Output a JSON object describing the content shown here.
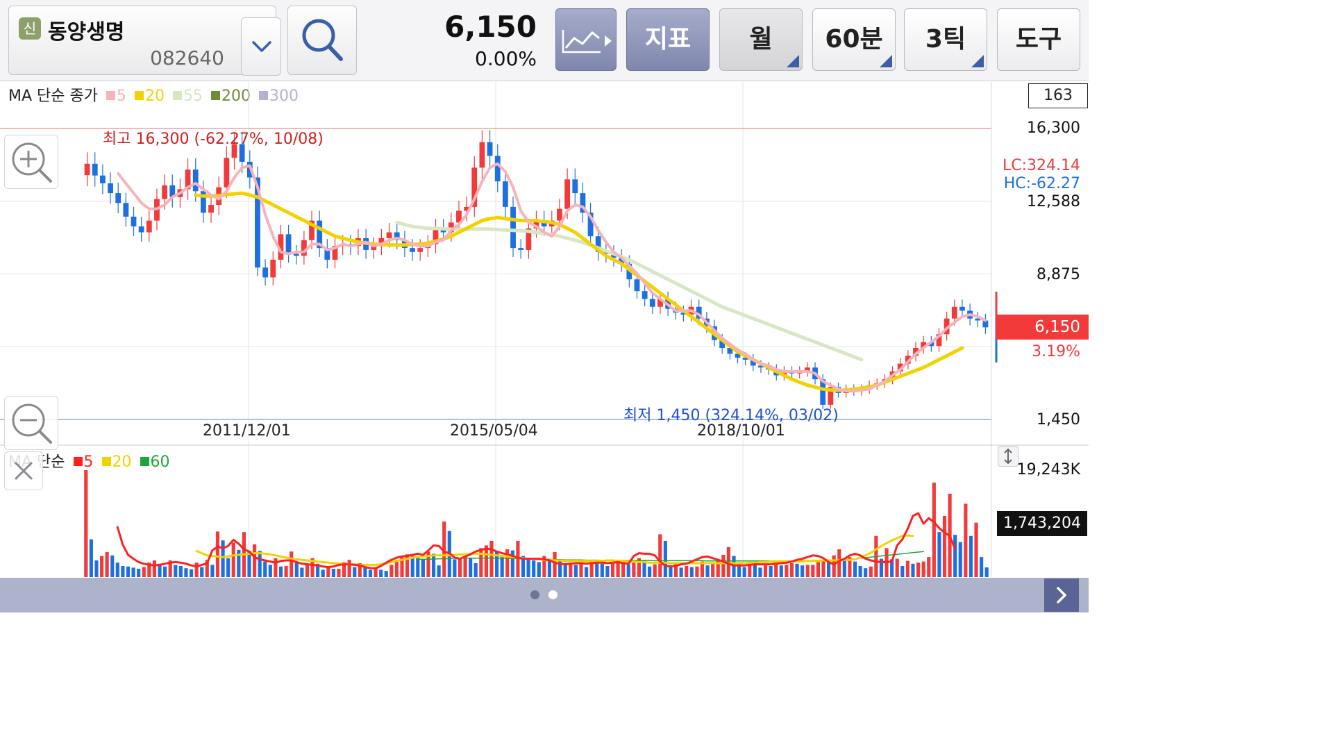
{
  "stock": {
    "badge": "신",
    "name": "동양생명",
    "code": "082640",
    "price": "6,150",
    "change": "0.00%"
  },
  "toolbar": {
    "indicator_label": "지표",
    "period_label": "월",
    "minute_label": "60분",
    "tick_label": "3틱",
    "tools_label": "도구"
  },
  "main_chart": {
    "legend_title": "MA 단순 종가",
    "legend_items": [
      {
        "label": "5",
        "color": "#f6b3ba"
      },
      {
        "label": "20",
        "color": "#f2d200"
      },
      {
        "label": "55",
        "color": "#d8e6c4"
      },
      {
        "label": "200",
        "color": "#6f8b3a"
      },
      {
        "label": "300",
        "color": "#b9aed6"
      }
    ],
    "count_box": "163",
    "high_label": "최고 16,300 (-62.27%, 10/08)",
    "low_label": "최저 1,450 (324.14%, 03/02)",
    "lc_label": "LC:324.14",
    "hc_label": "HC:-62.27",
    "y_labels": [
      "16,300",
      "12,588",
      "8,875",
      "1,450"
    ],
    "price_tag": "6,150",
    "price_pct": "3.19%",
    "x_labels": [
      "2011/12/01",
      "2015/05/04",
      "2018/10/01"
    ]
  },
  "volume_chart": {
    "legend_title": "MA 단순",
    "legend_items": [
      {
        "label": "5",
        "color": "#ff2020"
      },
      {
        "label": "20",
        "color": "#f2d200"
      },
      {
        "label": "60",
        "color": "#1aa63a"
      }
    ],
    "max_label": "19,243K",
    "current_label": "1,743,204"
  },
  "colors": {
    "up": "#f23a3a",
    "down": "#1e6fe0",
    "accent": "#7f87ae"
  },
  "chart_data": [
    {
      "type": "candlestick",
      "y_range": [
        1450,
        16300
      ],
      "y_ticks": [
        16300,
        12588,
        8875,
        5162,
        1450
      ],
      "x_tick_labels": [
        "2011/12/01",
        "2015/05/04",
        "2018/10/01"
      ],
      "last_close": 6150,
      "high": 16300,
      "low": 1450,
      "close": [
        14500,
        13900,
        13500,
        13000,
        12500,
        11800,
        11300,
        11000,
        11600,
        12700,
        13400,
        12800,
        13200,
        14200,
        13100,
        12000,
        12400,
        13300,
        14800,
        15500,
        14600,
        13800,
        9200,
        8700,
        9600,
        10900,
        9900,
        9800,
        10600,
        11600,
        10200,
        9600,
        10300,
        10400,
        10300,
        10700,
        10100,
        10300,
        10700,
        11000,
        10600,
        10200,
        10000,
        10200,
        10400,
        11200,
        11000,
        11500,
        12100,
        12300,
        14300,
        15600,
        14900,
        13600,
        12300,
        10200,
        10100,
        11200,
        11600,
        11300,
        11600,
        12200,
        13700,
        13000,
        12000,
        10800,
        10000,
        9900,
        9700,
        9400,
        8600,
        8000,
        7600,
        7200,
        7600,
        7100,
        6900,
        6800,
        7200,
        6600,
        6200,
        5500,
        5100,
        4800,
        4600,
        4500,
        4200,
        4100,
        4000,
        3700,
        3900,
        3800,
        3900,
        4100,
        3500,
        2200,
        3100,
        2800,
        3000,
        2900,
        3000,
        3200,
        3300,
        3500,
        3900,
        4300,
        4700,
        5100,
        5400,
        5200,
        5800,
        6600,
        7200,
        7000,
        6600,
        6500,
        6150
      ],
      "ma20": [
        null,
        null,
        null,
        null,
        null,
        null,
        null,
        null,
        null,
        null,
        null,
        null,
        null,
        null,
        12900,
        12850,
        12850,
        12880,
        12920,
        12960,
        13000,
        12900,
        12800,
        12600,
        12400,
        12200,
        12000,
        11800,
        11600,
        11400,
        11200,
        11000,
        10800,
        10700,
        10600,
        10500,
        10450,
        10400,
        10380,
        10360,
        10350,
        10360,
        10380,
        10400,
        10450,
        10550,
        10650,
        10800,
        11000,
        11200,
        11400,
        11600,
        11700,
        11750,
        11700,
        11650,
        11600,
        11600,
        11600,
        11550,
        11500,
        11400,
        11200,
        11000,
        10700,
        10400,
        10100,
        9800,
        9600,
        9400,
        9100,
        8800,
        8500,
        8200,
        7900,
        7600,
        7300,
        7000,
        6700,
        6400,
        6100,
        5800,
        5500,
        5200,
        4900,
        4700,
        4500,
        4300,
        4100,
        3900,
        3700,
        3500,
        3350,
        3200,
        3100,
        3000,
        2950,
        2950,
        2950,
        3000,
        3050,
        3100,
        3200,
        3350,
        3500,
        3650,
        3800,
        3950,
        4100,
        4300,
        4500,
        4700,
        4900,
        5100
      ],
      "ma55": [
        null,
        null,
        null,
        null,
        null,
        null,
        null,
        null,
        null,
        null,
        null,
        null,
        null,
        null,
        null,
        null,
        null,
        null,
        null,
        null,
        null,
        null,
        null,
        null,
        null,
        null,
        null,
        null,
        null,
        null,
        null,
        null,
        null,
        null,
        null,
        null,
        null,
        null,
        null,
        null,
        11500,
        11400,
        11300,
        11250,
        11200,
        11200,
        11180,
        11160,
        11150,
        11150,
        11160,
        11170,
        11160,
        11140,
        11120,
        11100,
        11080,
        11050,
        11000,
        10950,
        10880,
        10800,
        10700,
        10600,
        10480,
        10350,
        10200,
        10050,
        9900,
        9750,
        9600,
        9400,
        9200,
        9000,
        8800,
        8600,
        8400,
        8200,
        8000,
        7800,
        7600,
        7400,
        7200,
        7050,
        6900,
        6750,
        6600,
        6450,
        6300,
        6150,
        6000,
        5850,
        5700,
        5550,
        5400,
        5250,
        5100,
        4950,
        4800,
        4650,
        4500
      ],
      "ma5": [
        null,
        null,
        null,
        null,
        14000,
        13500,
        13000,
        12500,
        12200,
        12200,
        12400,
        12800,
        13000,
        13300,
        13500,
        13200,
        12900,
        12700,
        13100,
        13800,
        14300,
        14400,
        13300,
        11900,
        10800,
        10000,
        9900,
        10000,
        10000,
        10400,
        10400,
        10100,
        10200,
        10400,
        10300,
        10400,
        10500,
        10300,
        10400,
        10600,
        10700,
        10600,
        10400,
        10300,
        10300,
        10500,
        10600,
        11100,
        11400,
        11900,
        12700,
        13600,
        14300,
        14500,
        14100,
        13300,
        12100,
        11500,
        11300,
        11000,
        10800,
        11300,
        12100,
        12400,
        12300,
        11800,
        11100,
        10500,
        10000,
        9700,
        9300,
        8900,
        8400,
        7900,
        7600,
        7300,
        7000,
        7000,
        7000,
        6800,
        6400,
        6000,
        5600,
        5300,
        5000,
        4800,
        4500,
        4300,
        4200,
        4000,
        3900,
        3900,
        3900,
        3900,
        3800,
        3400,
        3200,
        3000,
        2900,
        2900,
        2950,
        3000,
        3200,
        3400,
        3700,
        4000,
        4400,
        4800,
        5100,
        5400,
        5700,
        6100,
        6400,
        6700,
        6800,
        6700,
        6500
      ]
    },
    {
      "type": "bar",
      "y_range": [
        0,
        19243000
      ],
      "current": 1743204,
      "values": [
        19243000,
        6800000,
        3000000,
        3800000,
        4500000,
        3900000,
        2600000,
        2000000,
        1900000,
        1700000,
        1500000,
        1800000,
        2600000,
        3000000,
        2400000,
        1900000,
        3000000,
        2200000,
        2000000,
        1600000,
        1400000,
        2600000,
        1800000,
        3100000,
        2200000,
        8200000,
        6600000,
        3400000,
        6200000,
        4900000,
        8100000,
        4700000,
        5900000,
        4700000,
        2800000,
        2200000,
        3400000,
        1900000,
        2000000,
        4600000,
        2800000,
        1700000,
        2400000,
        3400000,
        2400000,
        1300000,
        1700000,
        1500000,
        1500000,
        2700000,
        3100000,
        1800000,
        2500000,
        1800000,
        1300000,
        1700000,
        1300000,
        1100000,
        2200000,
        3100000,
        3500000,
        4100000,
        3800000,
        3500000,
        3300000,
        4600000,
        4200000,
        2100000,
        10000000,
        8300000,
        3200000,
        3300000,
        3800000,
        3400000,
        2500000,
        5200000,
        5700000,
        6500000,
        4600000,
        3600000,
        5000000,
        4800000,
        6500000,
        3800000,
        3500000,
        3000000,
        2700000,
        3800000,
        3300000,
        4500000,
        3200000,
        2500000,
        2600000,
        2200000,
        2500000,
        1800000,
        3000000,
        2600000,
        2400000,
        2000000,
        2500000,
        2700000,
        2800000,
        2300000,
        2600000,
        3400000,
        3000000,
        1900000,
        2300000,
        7700000,
        6500000,
        2100000,
        2300000,
        1700000,
        2000000,
        1800000,
        1900000,
        2800000,
        2100000,
        2500000,
        3000000,
        4000000,
        5400000,
        3800000,
        2600000,
        1800000,
        2400000,
        2300000,
        1700000,
        2100000,
        2000000,
        2700000,
        2100000,
        2200000,
        2500000,
        2400000,
        2100000,
        2200000,
        2200000,
        2700000,
        3100000,
        2900000,
        3900000,
        5000000,
        3200000,
        3600000,
        2800000,
        2000000,
        1600000,
        1900000,
        7400000,
        3300000,
        5200000,
        3200000,
        3300000,
        2000000,
        2900000,
        2400000,
        2600000,
        2800000,
        3600000,
        17000000,
        8100000,
        11000000,
        15000000,
        7600000,
        6300000,
        13200000,
        7400000,
        9800000,
        3600000,
        1743204
      ],
      "ma5": [
        null,
        null,
        null,
        null,
        null,
        null,
        9000000,
        5800000,
        4000000,
        3300000,
        2700000,
        2400000,
        2200000,
        2100000,
        2200000,
        2400000,
        2600000,
        2700000,
        2600000,
        2400000,
        2100000,
        1900000,
        2200000,
        2500000,
        4800000,
        5500000,
        5200000,
        5600000,
        6700000,
        6000000,
        5000000,
        4600000,
        3600000,
        3200000,
        3000000,
        2800000,
        2600000,
        2900000,
        3000000,
        3000000,
        2700000,
        2400000,
        2300000,
        2200000,
        2100000,
        1900000,
        1800000,
        1900000,
        2200000,
        2300000,
        2300000,
        2200000,
        2100000,
        1800000,
        1600000,
        1600000,
        2000000,
        2600000,
        3100000,
        3500000,
        3700000,
        3800000,
        4000000,
        4200000,
        4000000,
        4800000,
        5700000,
        5600000,
        4600000,
        4300000,
        3500000,
        3300000,
        3700000,
        4100000,
        4600000,
        4900000,
        5100000,
        5000000,
        4600000,
        4300000,
        4100000,
        3800000,
        3500000,
        3300000,
        3300000,
        3300000,
        3300000,
        3200000,
        3000000,
        2600000,
        2400000,
        2300000,
        2400000,
        2500000,
        2500000,
        2400000,
        2500000,
        2600000,
        2600000,
        2500000,
        2600000,
        2700000,
        2500000,
        2400000,
        3800000,
        4300000,
        4200000,
        4200000,
        3900000,
        2800000,
        2000000,
        1900000,
        2000000,
        2300000,
        2400000,
        2800000,
        3200000,
        3600000,
        3700000,
        3400000,
        3100000,
        2800000,
        2400000,
        2100000,
        2100000,
        2100000,
        2200000,
        2300000,
        2300000,
        2300000,
        2300000,
        2400000,
        2500000,
        2600000,
        2800000,
        3100000,
        3300000,
        3600000,
        3900000,
        3800000,
        3400000,
        2700000,
        2300000,
        2900000,
        3300000,
        3900000,
        4200000,
        3900000,
        3300000,
        3000000,
        2800000,
        2700000,
        2700000,
        2800000,
        5700000,
        6800000,
        8700000,
        11000000,
        11500000,
        9600000,
        10600000,
        9900000,
        8800000,
        8000000,
        7400000,
        5000000
      ],
      "ma20": [
        null,
        null,
        null,
        null,
        null,
        null,
        null,
        null,
        null,
        null,
        null,
        null,
        null,
        null,
        null,
        null,
        null,
        null,
        null,
        null,
        null,
        4700000,
        4300000,
        3900000,
        3800000,
        3700000,
        3600000,
        3700000,
        3900000,
        4000000,
        4100000,
        4200000,
        4300000,
        4300000,
        4200000,
        4100000,
        3900000,
        3700000,
        3500000,
        3300000,
        3200000,
        3100000,
        3000000,
        2900000,
        2800000,
        2700000,
        2600000,
        2500000,
        2400000,
        2400000,
        2300000,
        2300000,
        2200000,
        2200000,
        2200000,
        2200000,
        2300000,
        2500000,
        2700000,
        2900000,
        3100000,
        3300000,
        3500000,
        3600000,
        3700000,
        3800000,
        3900000,
        3900000,
        3900000,
        3900000,
        4000000,
        4100000,
        4100000,
        4200000,
        4200000,
        4200000,
        4100000,
        4000000,
        3900000,
        3800000,
        3700000,
        3600000,
        3500000,
        3400000,
        3300000,
        3300000,
        3200000,
        3100000,
        3100000,
        3000000,
        3000000,
        2900000,
        2900000,
        2900000,
        2900000,
        2900000,
        2900000,
        2900000,
        2900000,
        3000000,
        3000000,
        2900000,
        2900000,
        2800000,
        2800000,
        2700000,
        2700000,
        2600000,
        2600000,
        2600000,
        2600000,
        2500000,
        2500000,
        2500000,
        2500000,
        2500000,
        2500000,
        2500000,
        2500000,
        2500000,
        2500000,
        2500000,
        2500000,
        2500000,
        2500000,
        2500000,
        2600000,
        2600000,
        2700000,
        2700000,
        2800000,
        2800000,
        2800000,
        2800000,
        2800000,
        2800000,
        2800000,
        2900000,
        2900000,
        2900000,
        3000000,
        3000000,
        3000000,
        3000000,
        3100000,
        3100000,
        3200000,
        3500000,
        3900000,
        4400000,
        5000000,
        5600000,
        6100000,
        6600000,
        7000000,
        7400000,
        7500000,
        7400000
      ],
      "ma60": [
        null,
        null,
        null,
        null,
        null,
        null,
        null,
        null,
        null,
        null,
        null,
        null,
        null,
        null,
        null,
        null,
        null,
        null,
        null,
        null,
        null,
        null,
        null,
        null,
        null,
        null,
        null,
        null,
        null,
        null,
        null,
        null,
        null,
        null,
        null,
        null,
        null,
        null,
        null,
        null,
        null,
        null,
        null,
        null,
        null,
        null,
        null,
        null,
        null,
        null,
        null,
        null,
        null,
        null,
        null,
        null,
        null,
        null,
        null,
        null,
        null,
        null,
        null,
        3200000,
        3200000,
        3200000,
        3250000,
        3300000,
        3300000,
        3350000,
        3400000,
        3400000,
        3400000,
        3400000,
        3400000,
        3400000,
        3400000,
        3400000,
        3400000,
        3400000,
        3400000,
        3350000,
        3350000,
        3300000,
        3300000,
        3250000,
        3250000,
        3200000,
        3200000,
        3150000,
        3150000,
        3100000,
        3100000,
        3100000,
        3100000,
        3050000,
        3050000,
        3050000,
        3000000,
        3000000,
        3000000,
        3000000,
        3000000,
        3000000,
        3000000,
        3000000,
        3000000,
        3000000,
        2950000,
        2950000,
        2950000,
        2950000,
        2950000,
        2950000,
        2950000,
        2950000,
        2950000,
        2950000,
        2900000,
        2900000,
        2900000,
        2900000,
        2900000,
        2900000,
        2900000,
        2900000,
        2900000,
        2900000,
        2900000,
        2900000,
        2900000,
        2900000,
        2900000,
        2900000,
        2900000,
        2950000,
        2950000,
        2950000,
        3000000,
        3000000,
        3000000,
        3050000,
        3050000,
        3100000,
        3150000,
        3200000,
        3300000,
        3400000,
        3500000,
        3600000,
        3700000,
        3800000,
        3900000,
        4000000,
        4100000,
        4200000,
        4300000,
        4400000,
        4500000,
        4600000
      ]
    }
  ]
}
